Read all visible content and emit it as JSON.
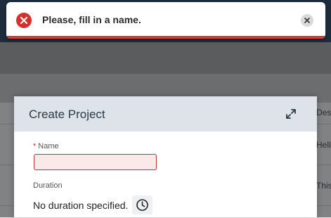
{
  "toast": {
    "message": "Please, fill in a name.",
    "icon": "error-x-icon",
    "close_icon": "close-icon",
    "accent_color": "#d33b38"
  },
  "background_table": {
    "cells": [
      "Des",
      "Hello",
      "This"
    ]
  },
  "dialog": {
    "title": "Create Project",
    "expand_icon": "expand-icon",
    "fields": {
      "name": {
        "label": "Name",
        "required_marker": "*",
        "value": "",
        "state": "error"
      },
      "duration": {
        "label": "Duration",
        "value": "No duration specified.",
        "button_icon": "clock-icon"
      }
    }
  }
}
